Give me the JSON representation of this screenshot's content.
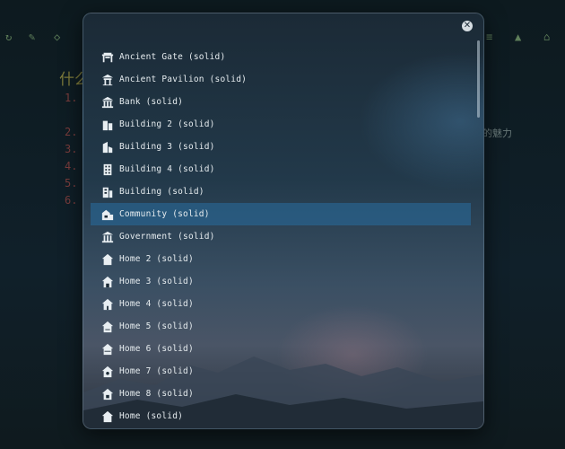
{
  "background": {
    "heading": "什么",
    "list_numbers": [
      "1.",
      "2.",
      "3.",
      "4.",
      "5.",
      "6."
    ],
    "side_text": "的魅力"
  },
  "dialog": {
    "close_icon": "close-icon",
    "items": [
      {
        "label": "Ancient Gate (solid)",
        "icon": "ancient-gate-icon"
      },
      {
        "label": "Ancient Pavilion (solid)",
        "icon": "ancient-pavilion-icon"
      },
      {
        "label": "Bank (solid)",
        "icon": "bank-icon"
      },
      {
        "label": "Building 2 (solid)",
        "icon": "building-2-icon"
      },
      {
        "label": "Building 3 (solid)",
        "icon": "building-3-icon"
      },
      {
        "label": "Building 4 (solid)",
        "icon": "building-4-icon"
      },
      {
        "label": "Building (solid)",
        "icon": "building-icon"
      },
      {
        "label": "Community (solid)",
        "icon": "community-icon",
        "selected": true
      },
      {
        "label": "Government (solid)",
        "icon": "government-icon"
      },
      {
        "label": "Home 2 (solid)",
        "icon": "home-2-icon"
      },
      {
        "label": "Home 3 (solid)",
        "icon": "home-3-icon"
      },
      {
        "label": "Home 4 (solid)",
        "icon": "home-4-icon"
      },
      {
        "label": "Home 5 (solid)",
        "icon": "home-5-icon"
      },
      {
        "label": "Home 6 (solid)",
        "icon": "home-6-icon"
      },
      {
        "label": "Home 7 (solid)",
        "icon": "home-7-icon"
      },
      {
        "label": "Home 8 (solid)",
        "icon": "home-8-icon"
      },
      {
        "label": "Home (solid)",
        "icon": "home-icon"
      }
    ]
  },
  "colors": {
    "selected_row": "#2a6ea0",
    "item_text": "#e6ecef"
  }
}
